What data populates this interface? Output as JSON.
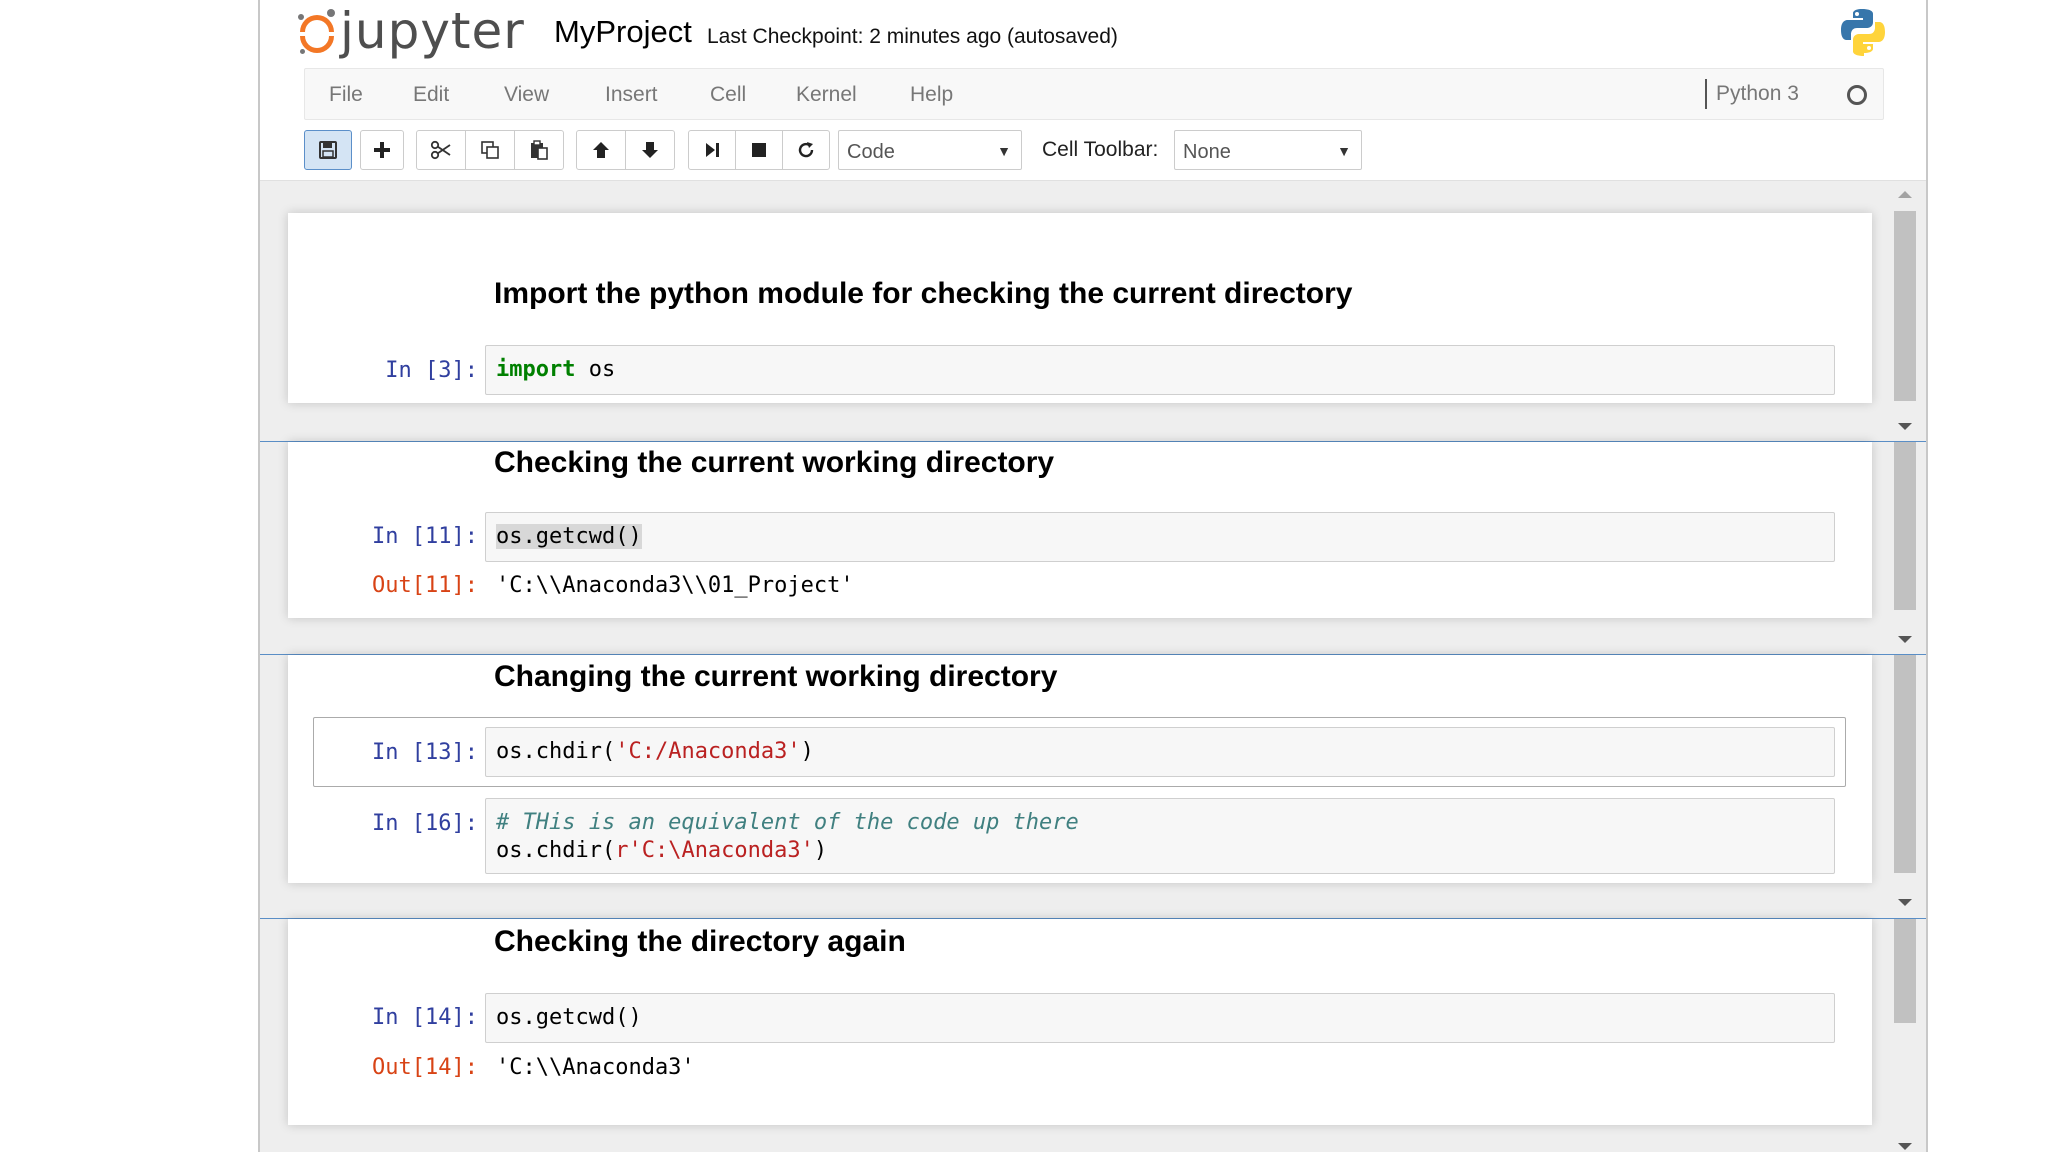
{
  "header": {
    "logo_text": "jupyter",
    "notebook_name": "MyProject",
    "checkpoint": "Last Checkpoint: 2 minutes ago (autosaved)"
  },
  "menu": [
    "File",
    "Edit",
    "View",
    "Insert",
    "Cell",
    "Kernel",
    "Help"
  ],
  "kernel": {
    "name": "Python 3"
  },
  "toolbar": {
    "cell_type": "Code",
    "cell_toolbar_label": "Cell Toolbar:",
    "cell_toolbar_value": "None",
    "icons": [
      "save-icon",
      "plus-icon",
      "scissors-icon",
      "copy-icon",
      "paste-icon",
      "arrow-up-icon",
      "arrow-down-icon",
      "step-forward-icon",
      "stop-icon",
      "refresh-icon"
    ]
  },
  "cells": {
    "p1_heading": "Import the python module for checking the current directory",
    "p1_in_prompt": "In [3]:",
    "p1_code_kw": "import",
    "p1_code_rest": " os",
    "p2_heading": "Checking the current working directory",
    "p2_in_prompt": "In [11]:",
    "p2_code": "os.getcwd()",
    "p2_out_prompt": "Out[11]:",
    "p2_output": "'C:\\\\Anaconda3\\\\01_Project'",
    "p3_heading": "Changing the current working directory",
    "p3_in1_prompt": "In [13]:",
    "p3_code1_a": "os.chdir(",
    "p3_code1_str": "'C:/Anaconda3'",
    "p3_code1_b": ")",
    "p3_in2_prompt": "In [16]:",
    "p3_code2_comment": "# THis is an equivalent of the code up there",
    "p3_code2_a": "os.chdir(",
    "p3_code2_str": "r'C:\\Anaconda3'",
    "p3_code2_b": ")",
    "p4_heading": "Checking the directory again",
    "p4_in_prompt": "In [14]:",
    "p4_code": "os.getcwd()",
    "p4_out_prompt": "Out[14]:",
    "p4_output": "'C:\\\\Anaconda3'"
  },
  "colors": {
    "logo_orange": "#f37726",
    "in_prompt": "#303f9f",
    "out_prompt": "#d84315",
    "keyword": "#008000",
    "string": "#ba2121",
    "comment": "#408080",
    "panel_separator": "#5a8ec6"
  }
}
